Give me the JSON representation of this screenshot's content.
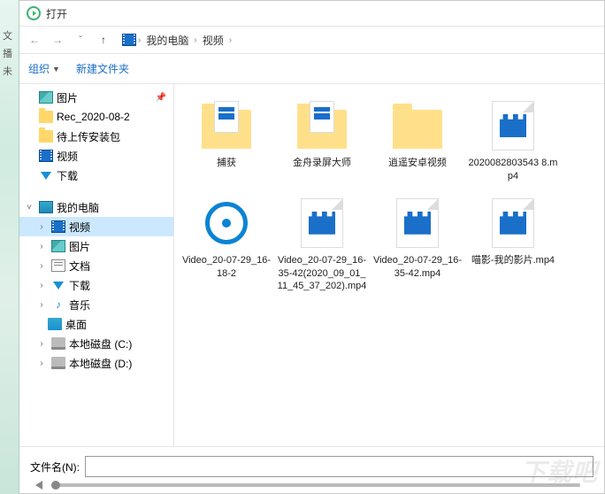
{
  "left_strip": {
    "l1": "文",
    "l2": "播",
    "l3": "未"
  },
  "title": "打开",
  "nav": {
    "back": "←",
    "fwd": "→",
    "up": "↑",
    "caret": "ˇ"
  },
  "breadcrumb": {
    "root": "我的电脑",
    "current": "视频",
    "sep": "›"
  },
  "toolbar": {
    "organize": "组织",
    "newfolder": "新建文件夹"
  },
  "quick": {
    "pictures": "图片",
    "rec": "Rec_2020-08-2",
    "upload": "待上传安装包",
    "video": "视频",
    "downloads": "下载"
  },
  "tree": {
    "mypc": "我的电脑",
    "video": "视频",
    "pictures": "图片",
    "docs": "文档",
    "downloads": "下载",
    "music": "音乐",
    "desktop": "桌面",
    "drivec": "本地磁盘 (C:)",
    "drived": "本地磁盘 (D:)"
  },
  "files": {
    "f0": "捕获",
    "f1": "金舟录屏大师",
    "f2": "逍遥安卓视频",
    "f3": "2020082803543\n8.mp4",
    "f4": "Video_20-07-29_16-18-2",
    "f5": "Video_20-07-29_16-35-42(2020_09_01_11_45_37_202).mp4",
    "f6": "Video_20-07-29_16-35-42.mp4",
    "f7": "喵影-我的影片.mp4"
  },
  "bottom": {
    "fname_label": "文件名(N):",
    "fname_value": ""
  },
  "watermark": "下载吧"
}
